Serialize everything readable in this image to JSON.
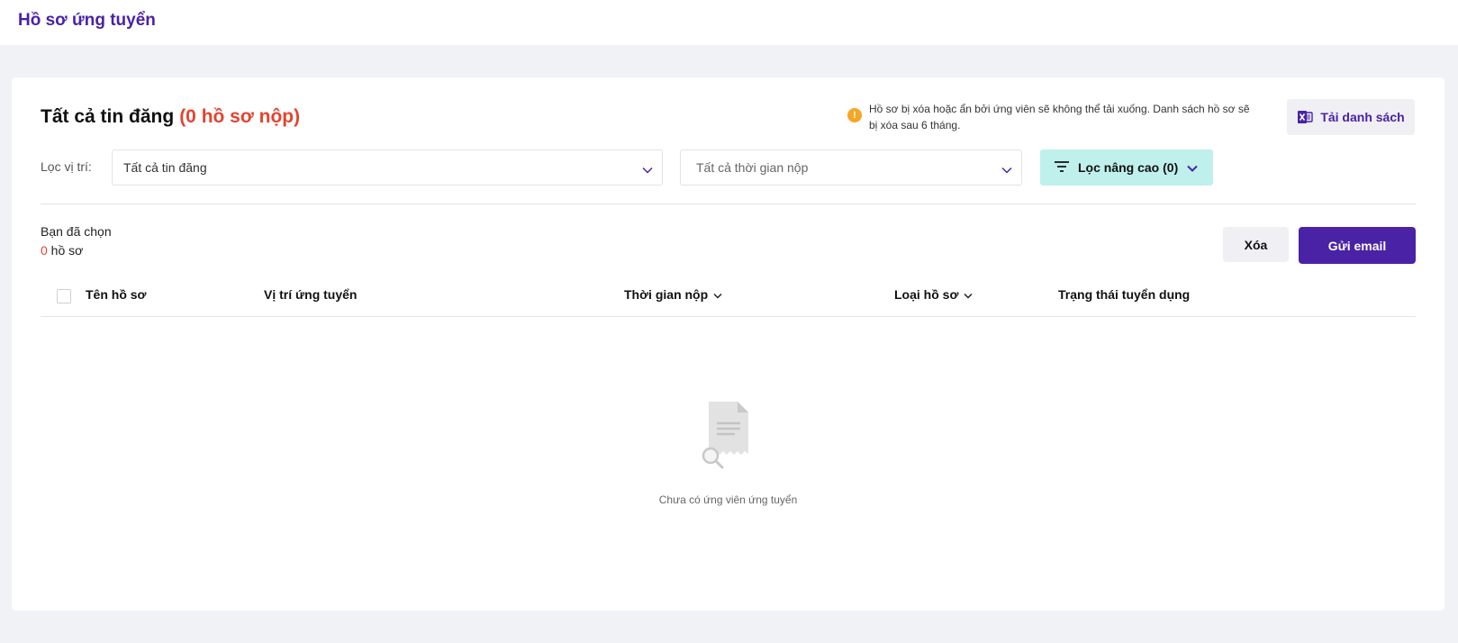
{
  "header": {
    "title": "Hồ sơ ứng tuyển"
  },
  "main": {
    "heading": "Tất cả tin đăng",
    "heading_count": "(0 hồ sơ nộp)",
    "notice": "Hồ sơ bị xóa hoặc ẩn bởi ứng viên sẽ không thể tải xuống. Danh sách hồ sơ sẽ bị xóa sau 6 tháng.",
    "download_label": "Tải danh sách",
    "filter": {
      "label": "Lọc vị trí:",
      "position_value": "Tất cả tin đăng",
      "time_value": "Tất cả thời gian nộp",
      "advanced_label": "Lọc nâng cao (0)"
    },
    "selection": {
      "line1": "Bạn đã chọn",
      "count": "0",
      "unit": " hồ sơ"
    },
    "actions": {
      "delete_label": "Xóa",
      "email_label": "Gửi email"
    },
    "table": {
      "columns": [
        "Tên hồ sơ",
        "Vị trí ứng tuyển",
        "Thời gian nộp",
        "Loại hồ sơ",
        "Trạng thái tuyển dụng"
      ]
    },
    "empty_text": "Chưa có ứng viên ứng tuyển"
  },
  "colors": {
    "brand": "#4a22a6",
    "count": "#e5432f",
    "advanced_filter_bg": "#bff0ec",
    "warning": "#f5a623"
  }
}
